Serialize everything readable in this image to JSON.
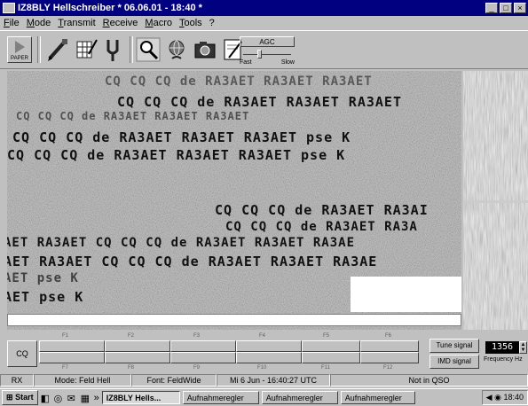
{
  "window": {
    "title": "IZ8BLY Hellschreiber  * 06.06.01 - 18:40 *"
  },
  "menu": [
    "File",
    "Mode",
    "Transmit",
    "Receive",
    "Macro",
    "Tools",
    "?"
  ],
  "toolbar": {
    "paper_label": "PAPER",
    "agc_label": "AGC",
    "agc_fast": "Fast",
    "agc_slow": "Slow"
  },
  "display": {
    "rows": [
      "CQ CQ CQ de RA3AET RA3AET RA3AET",
      "CQ CQ CQ de RA3AET RA3AET RA3AET",
      "CQ CQ CQ de RA3AET RA3AET RA3AET",
      "CQ CQ CQ de RA3AET RA3AET RA3AET  pse K",
      "CQ CQ CQ de RA3AET RA3AET RA3AET  pse K",
      "CQ CQ CQ de RA3AET RA3AI",
      "CQ CQ CQ de RA3AET RA3A",
      "AET RA3AET  CQ CQ CQ de RA3AET RA3AET RA3AE",
      "AET RA3AET  CQ CQ CQ de RA3AET RA3AET RA3AE",
      "AET  pse K",
      "AET  pse K"
    ]
  },
  "macros": {
    "cq_label": "CQ",
    "fkeys_top": [
      "F1",
      "F2",
      "F3",
      "F4",
      "F5",
      "F6"
    ],
    "fkeys_bottom": [
      "F7",
      "F8",
      "F9",
      "F10",
      "F11",
      "F12"
    ]
  },
  "signals": {
    "tune_label": "Tune signal",
    "imd_label": "IMD signal",
    "frequency": "1356",
    "frequency_label": "Frequency Hz"
  },
  "status": {
    "rx": "RX",
    "mode": "Mode: Feld Hell",
    "font": "Font: FeldWide",
    "datetime": "Mi 6 Jun - 16:40:27 UTC",
    "qso": "Not in QSO"
  },
  "taskbar": {
    "start": "Start",
    "more": "»",
    "buttons": [
      "IZ8BLY Hells...",
      "Aufnahmeregler",
      "Aufnahmeregler",
      "Aufnahmeregler"
    ],
    "clock": "18:40"
  }
}
